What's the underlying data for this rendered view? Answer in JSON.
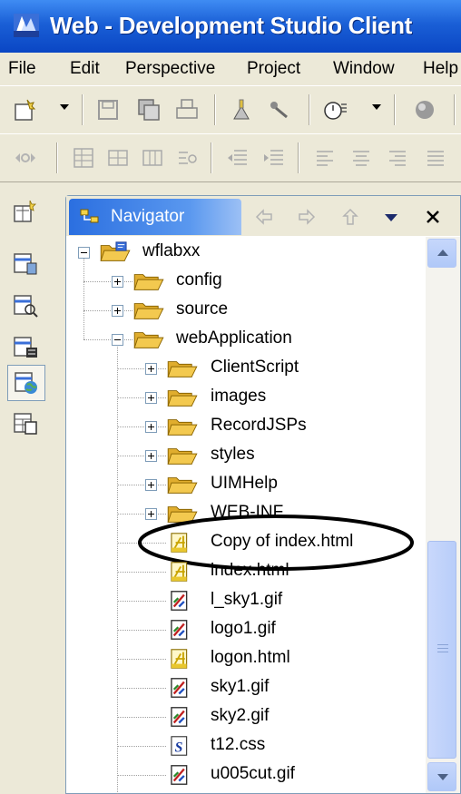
{
  "window": {
    "title": "Web - Development Studio Client"
  },
  "menu": [
    "File",
    "Edit",
    "Perspective",
    "Project",
    "Window",
    "Help"
  ],
  "navigator": {
    "tab_label": "Navigator"
  },
  "tree": [
    {
      "label": "wflabxx",
      "icon": "project-folder-icon",
      "level": 0,
      "expander": "minus"
    },
    {
      "label": "config",
      "icon": "folder-icon",
      "level": 1,
      "expander": "plus"
    },
    {
      "label": "source",
      "icon": "folder-icon",
      "level": 1,
      "expander": "plus"
    },
    {
      "label": "webApplication",
      "icon": "folder-icon",
      "level": 1,
      "expander": "minus"
    },
    {
      "label": "ClientScript",
      "icon": "folder-icon",
      "level": 2,
      "expander": "plus"
    },
    {
      "label": "images",
      "icon": "folder-icon",
      "level": 2,
      "expander": "plus"
    },
    {
      "label": "RecordJSPs",
      "icon": "folder-icon",
      "level": 2,
      "expander": "plus"
    },
    {
      "label": "styles",
      "icon": "folder-icon",
      "level": 2,
      "expander": "plus"
    },
    {
      "label": "UIMHelp",
      "icon": "folder-icon",
      "level": 2,
      "expander": "plus"
    },
    {
      "label": "WEB-INF",
      "icon": "folder-icon",
      "level": 2,
      "expander": "plus"
    },
    {
      "label": "Copy of index.html",
      "icon": "html-file-icon",
      "level": 2,
      "expander": "none",
      "highlighted": true
    },
    {
      "label": "index.html",
      "icon": "html-file-icon",
      "level": 2,
      "expander": "none"
    },
    {
      "label": "l_sky1.gif",
      "icon": "image-file-icon",
      "level": 2,
      "expander": "none"
    },
    {
      "label": "logo1.gif",
      "icon": "image-file-icon",
      "level": 2,
      "expander": "none"
    },
    {
      "label": "logon.html",
      "icon": "html-file-icon",
      "level": 2,
      "expander": "none"
    },
    {
      "label": "sky1.gif",
      "icon": "image-file-icon",
      "level": 2,
      "expander": "none"
    },
    {
      "label": "sky2.gif",
      "icon": "image-file-icon",
      "level": 2,
      "expander": "none"
    },
    {
      "label": "t12.css",
      "icon": "css-file-icon",
      "level": 2,
      "expander": "none"
    },
    {
      "label": "u005cut.gif",
      "icon": "image-file-icon",
      "level": 2,
      "expander": "none"
    }
  ],
  "colors": {
    "title_bar": "#0a46c4",
    "nav_tab": "#2b6fe0",
    "folder": "#f3c94f",
    "highlight_ellipse": "#000000"
  }
}
